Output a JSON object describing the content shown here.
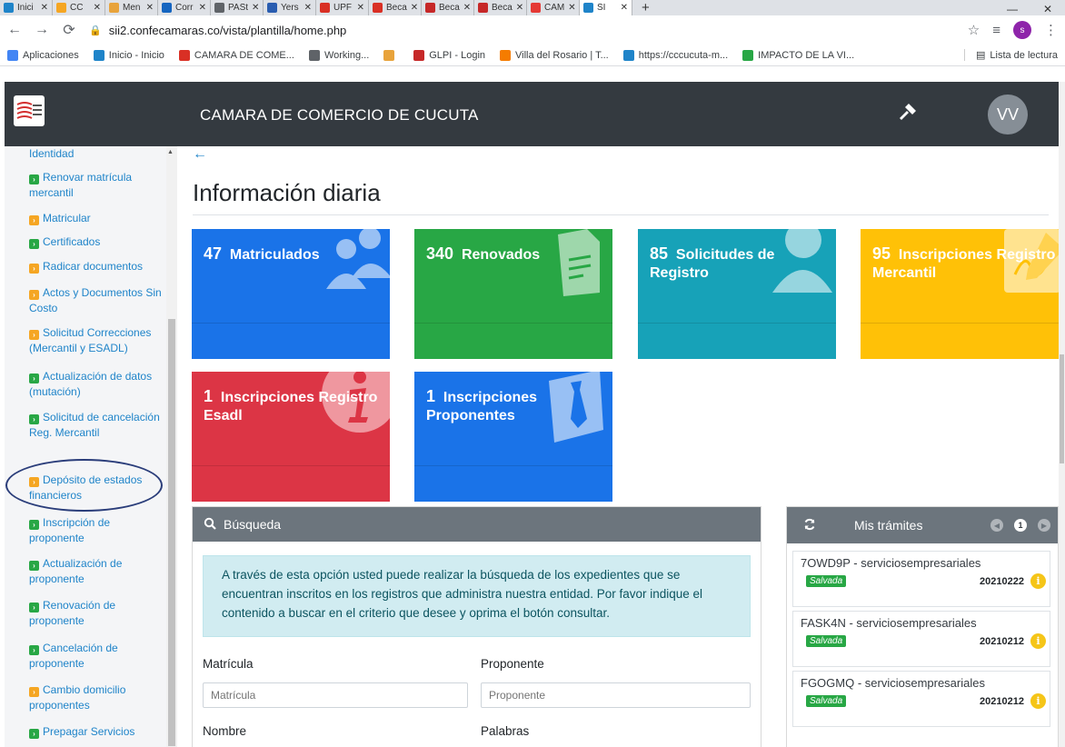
{
  "browser": {
    "tabs": [
      {
        "label": "Inici",
        "color": "#1f84c9"
      },
      {
        "label": "CC",
        "color": "#f5a623"
      },
      {
        "label": "Men",
        "color": "#e8a33b"
      },
      {
        "label": "Corr",
        "color": "#1565c0"
      },
      {
        "label": "PASt",
        "color": "#5f6368"
      },
      {
        "label": "Yers",
        "color": "#2a5db0"
      },
      {
        "label": "UPF",
        "color": "#d93025"
      },
      {
        "label": "Beca",
        "color": "#d93025"
      },
      {
        "label": "Beca",
        "color": "#c62828"
      },
      {
        "label": "Beca",
        "color": "#c62828"
      },
      {
        "label": "CAM",
        "color": "#e53935"
      },
      {
        "label": "SI",
        "color": "#1f84c9"
      }
    ],
    "url": "sii2.confecamaras.co/vista/plantilla/home.php",
    "profile_initial": "s",
    "bookmarks": [
      {
        "label": "Aplicaciones",
        "color": "#4285f4"
      },
      {
        "label": "Inicio - Inicio",
        "color": "#1f84c9"
      },
      {
        "label": "CAMARA DE COME...",
        "color": "#d93025"
      },
      {
        "label": "Working...",
        "color": "#5f6368"
      },
      {
        "label": "",
        "color": "#e8a33b"
      },
      {
        "label": "GLPI - Login",
        "color": "#c62828"
      },
      {
        "label": "Villa del Rosario | T...",
        "color": "#f57c00"
      },
      {
        "label": "https://cccucuta-m...",
        "color": "#1f84c9"
      },
      {
        "label": "IMPACTO DE LA VI...",
        "color": "#28a745"
      }
    ],
    "reading_list": "Lista de lectura"
  },
  "header": {
    "title": "CAMARA DE COMERCIO DE CUCUTA",
    "avatar": "VV",
    "logo_text": "CÁMARA DE COMERCIO DE CÚCUTA"
  },
  "sidebar": {
    "items": [
      {
        "label": "Identidad",
        "chev": ""
      },
      {
        "label": "Renovar matrícula mercantil",
        "chev": "green"
      },
      {
        "label": "Matricular",
        "chev": "orange"
      },
      {
        "label": "Certificados",
        "chev": "green"
      },
      {
        "label": "Radicar documentos",
        "chev": "orange"
      },
      {
        "label": "Actos y Documentos Sin Costo",
        "chev": "orange"
      },
      {
        "label": "Solicitud Correcciones (Mercantil y ESADL)",
        "chev": "orange"
      },
      {
        "label": "Actualización de datos (mutación)",
        "chev": "green"
      },
      {
        "label": "Solicitud de cancelación Reg. Mercantil",
        "chev": "green"
      },
      {
        "label": "Depósito de estados financieros",
        "chev": "orange"
      },
      {
        "label": "Inscripción de proponente",
        "chev": "green"
      },
      {
        "label": "Actualización de proponente",
        "chev": "green"
      },
      {
        "label": "Renovación de proponente",
        "chev": "green"
      },
      {
        "label": "Cancelación de proponente",
        "chev": "green"
      },
      {
        "label": "Cambio domicilio proponentes",
        "chev": "orange"
      },
      {
        "label": "Prepagar Servicios",
        "chev": "green"
      }
    ]
  },
  "main": {
    "title": "Información diaria",
    "cards": [
      {
        "num": "47",
        "label": "Matriculados",
        "color": "#1a73e8",
        "icon": "users-icon"
      },
      {
        "num": "340",
        "label": "Renovados",
        "color": "#28a745",
        "icon": "document-icon"
      },
      {
        "num": "85",
        "label": "Solicitudes de Registro",
        "color": "#17a2b8",
        "icon": "user-icon"
      },
      {
        "num": "95",
        "label": "Inscripciones Registro Mercantil",
        "color": "#ffc107",
        "icon": "signature-icon"
      },
      {
        "num": "1",
        "label": "Inscripciones Registro Esadl",
        "color": "#dc3545",
        "icon": "info-icon"
      },
      {
        "num": "1",
        "label": "Inscripciones Proponentes",
        "color": "#1a73e8",
        "icon": "tie-icon"
      }
    ]
  },
  "search": {
    "title": "Búsqueda",
    "info": "A través de esta opción usted puede realizar la búsqueda de los expedientes que se encuentran inscritos en los registros que administra nuestra entidad. Por favor indique el contenido a buscar en el criterio que desee y oprima el botón consultar.",
    "matricula_label": "Matrícula",
    "matricula_placeholder": "Matrícula",
    "proponente_label": "Proponente",
    "proponente_placeholder": "Proponente",
    "nombre_label": "Nombre",
    "palabras_label": "Palabras"
  },
  "tramites": {
    "title": "Mis trámites",
    "page": "1",
    "items": [
      {
        "title": "7OWD9P - serviciosempresariales",
        "status": "Salvada",
        "date": "20210222"
      },
      {
        "title": "FASK4N - serviciosempresariales",
        "status": "Salvada",
        "date": "20210212"
      },
      {
        "title": "FGOGMQ - serviciosempresariales",
        "status": "Salvada",
        "date": "20210212"
      }
    ]
  }
}
